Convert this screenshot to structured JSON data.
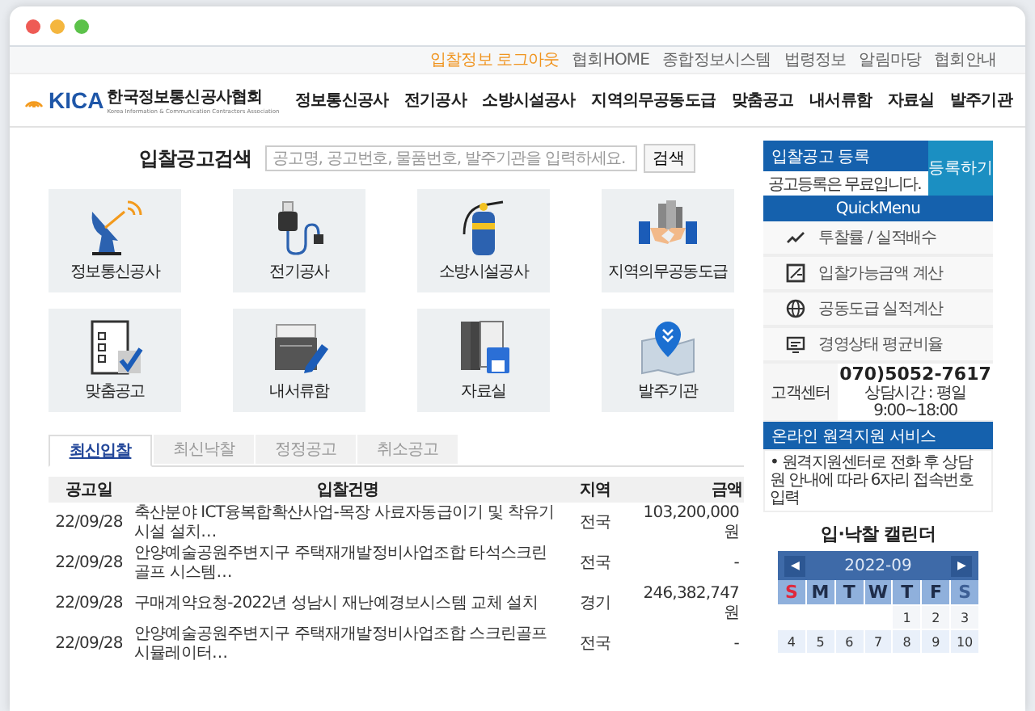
{
  "util_links": [
    {
      "label": "입찰정보 로그아웃",
      "selected": true
    },
    {
      "label": "협회HOME",
      "selected": false
    },
    {
      "label": "종합정보시스템",
      "selected": false
    },
    {
      "label": "법령정보",
      "selected": false
    },
    {
      "label": "알림마당",
      "selected": false
    },
    {
      "label": "협회안내",
      "selected": false
    }
  ],
  "logo": {
    "mark": "KICA",
    "name": "한국정보통신공사협회",
    "subtitle": "Korea Information & Communication Contractors Association"
  },
  "nav": [
    "정보통신공사",
    "전기공사",
    "소방시설공사",
    "지역의무공동도급",
    "맞춤공고",
    "내서류함",
    "자료실",
    "발주기관"
  ],
  "search": {
    "label": "입찰공고검색",
    "placeholder": "공고명, 공고번호, 물품번호, 발주기관을 입력하세요.",
    "button": "검색"
  },
  "tiles": [
    {
      "kind": "dish",
      "label": "정보통신공사"
    },
    {
      "kind": "plug",
      "label": "전기공사"
    },
    {
      "kind": "extinguisher",
      "label": "소방시설공사"
    },
    {
      "kind": "handshake",
      "label": "지역의무공동도급"
    },
    {
      "kind": "checklist",
      "label": "맞춤공고"
    },
    {
      "kind": "document",
      "label": "내서류함"
    },
    {
      "kind": "binder",
      "label": "자료실"
    },
    {
      "kind": "pin",
      "label": "발주기관"
    }
  ],
  "tabs": [
    {
      "label": "최신입찰",
      "selected": true
    },
    {
      "label": "최신낙찰",
      "selected": false
    },
    {
      "label": "정정공고",
      "selected": false
    },
    {
      "label": "취소공고",
      "selected": false
    }
  ],
  "table": {
    "columns": [
      "공고일",
      "입찰건명",
      "지역",
      "금액"
    ],
    "rows": [
      [
        "22/09/28",
        "축산분야 ICT융복합확산사업-목장 사료자동급이기 및 착유기 시설 설치…",
        "전국",
        "103,200,000원"
      ],
      [
        "22/09/28",
        "안양예술공원주변지구 주택재개발정비사업조합 타석스크린골프 시스템…",
        "전국",
        "-"
      ],
      [
        "22/09/28",
        "구매계약요청-2022년 성남시 재난예경보시스템 교체 설치",
        "경기",
        "246,382,747원"
      ],
      [
        "22/09/28",
        "안양예술공원주변지구 주택재개발정비사업조합 스크린골프 시뮬레이터…",
        "전국",
        "-"
      ]
    ]
  },
  "register": {
    "title": "입찰공고 등록",
    "note": "공고등록은 무료입니다.",
    "button": "등록하기"
  },
  "quick_menu": {
    "title": "QuickMenu",
    "items": [
      {
        "kind": "chart",
        "label": "투찰률 / 실적배수"
      },
      {
        "kind": "calc",
        "label": "입찰가능금액 계산"
      },
      {
        "kind": "globe",
        "label": "공동도급 실적계산"
      },
      {
        "kind": "monitor",
        "label": "경영상태 평균비율"
      }
    ]
  },
  "support": {
    "label": "고객센터",
    "phone": "070)5052-7617",
    "hours": "상담시간 : 평일 9:00~18:00"
  },
  "remote": {
    "title": "온라인 원격지원 서비스",
    "text": "• 원격지원센터로 전화 후 상담원 안내에 따라 6자리 접속번호 입력"
  },
  "calendar": {
    "title": "입·낙찰 캘린더",
    "prev": "◀",
    "month": "2022-09",
    "next": "▶",
    "weekdays": [
      {
        "label": "S",
        "kind": "sunday"
      },
      {
        "label": "M",
        "kind": "weekday"
      },
      {
        "label": "T",
        "kind": "weekday"
      },
      {
        "label": "W",
        "kind": "weekday"
      },
      {
        "label": "T",
        "kind": "weekday"
      },
      {
        "label": "F",
        "kind": "weekday"
      },
      {
        "label": "S",
        "kind": "saturday"
      }
    ],
    "weeks": [
      [
        "1",
        "2",
        "3"
      ],
      [
        "4",
        "5",
        "6",
        "7",
        "8",
        "9",
        "10"
      ]
    ]
  }
}
